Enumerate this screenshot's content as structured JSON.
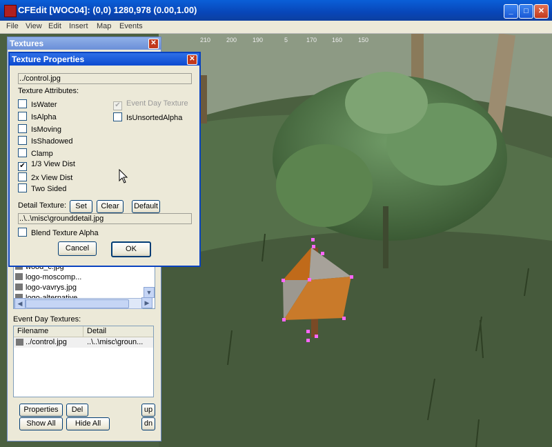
{
  "window": {
    "title": "CFEdit [WOC04]: (0,0) 1280,978  (0.00,1.00)",
    "minimize": "_",
    "maximize": "□",
    "close": "✕"
  },
  "menu": [
    "File",
    "View",
    "Edit",
    "Insert",
    "Map",
    "Events"
  ],
  "ruler": [
    "210",
    "200",
    "190",
    "5",
    "170",
    "160",
    "150"
  ],
  "textures_panel": {
    "title": "Textures",
    "close": "✕",
    "list_items": [
      "wood_c.jpg",
      "logo-moscomp...",
      "logo-vavrys.jpg",
      "logo-alternative"
    ],
    "event_day_label": "Event Day Textures:",
    "columns": [
      "Filename",
      "Detail"
    ],
    "rows": [
      {
        "filename": "../control.jpg",
        "detail": "..\\..\\misc\\groun..."
      }
    ],
    "buttons": {
      "properties": "Properties",
      "del": "Del",
      "up": "up",
      "show_all": "Show All",
      "hide_all": "Hide All",
      "dn": "dn"
    }
  },
  "dialog": {
    "title": "Texture Properties",
    "close": "✕",
    "texture_file": "../control.jpg",
    "attributes_label": "Texture Attributes:",
    "checkboxes": [
      {
        "label": "IsWater",
        "checked": false
      },
      {
        "label": "IsAlpha",
        "checked": false
      },
      {
        "label": "IsMoving",
        "checked": false
      },
      {
        "label": "IsShadowed",
        "checked": false
      },
      {
        "label": "Clamp",
        "checked": false
      },
      {
        "label": "1/3 View Dist",
        "checked": true
      },
      {
        "label": "2x View Dist",
        "checked": false
      },
      {
        "label": "Two Sided",
        "checked": false
      }
    ],
    "event_day_texture": {
      "label": "Event Day Texture",
      "checked": true,
      "disabled": true
    },
    "unsorted_alpha": {
      "label": "IsUnsortedAlpha",
      "checked": false
    },
    "detail_label": "Detail Texture:",
    "detail_buttons": {
      "set": "Set",
      "clear": "Clear",
      "default": "Default"
    },
    "detail_file": "..\\..\\misc\\grounddetail.jpg",
    "blend_alpha": {
      "label": "Blend Texture Alpha",
      "checked": false
    },
    "cancel": "Cancel",
    "ok": "OK"
  },
  "colors": {
    "titlebar": "#0a5fd8",
    "panel": "#ece9d8",
    "grass": "#475c3c",
    "selection": "#ff66ff",
    "sign_orange": "#c06a1a"
  }
}
